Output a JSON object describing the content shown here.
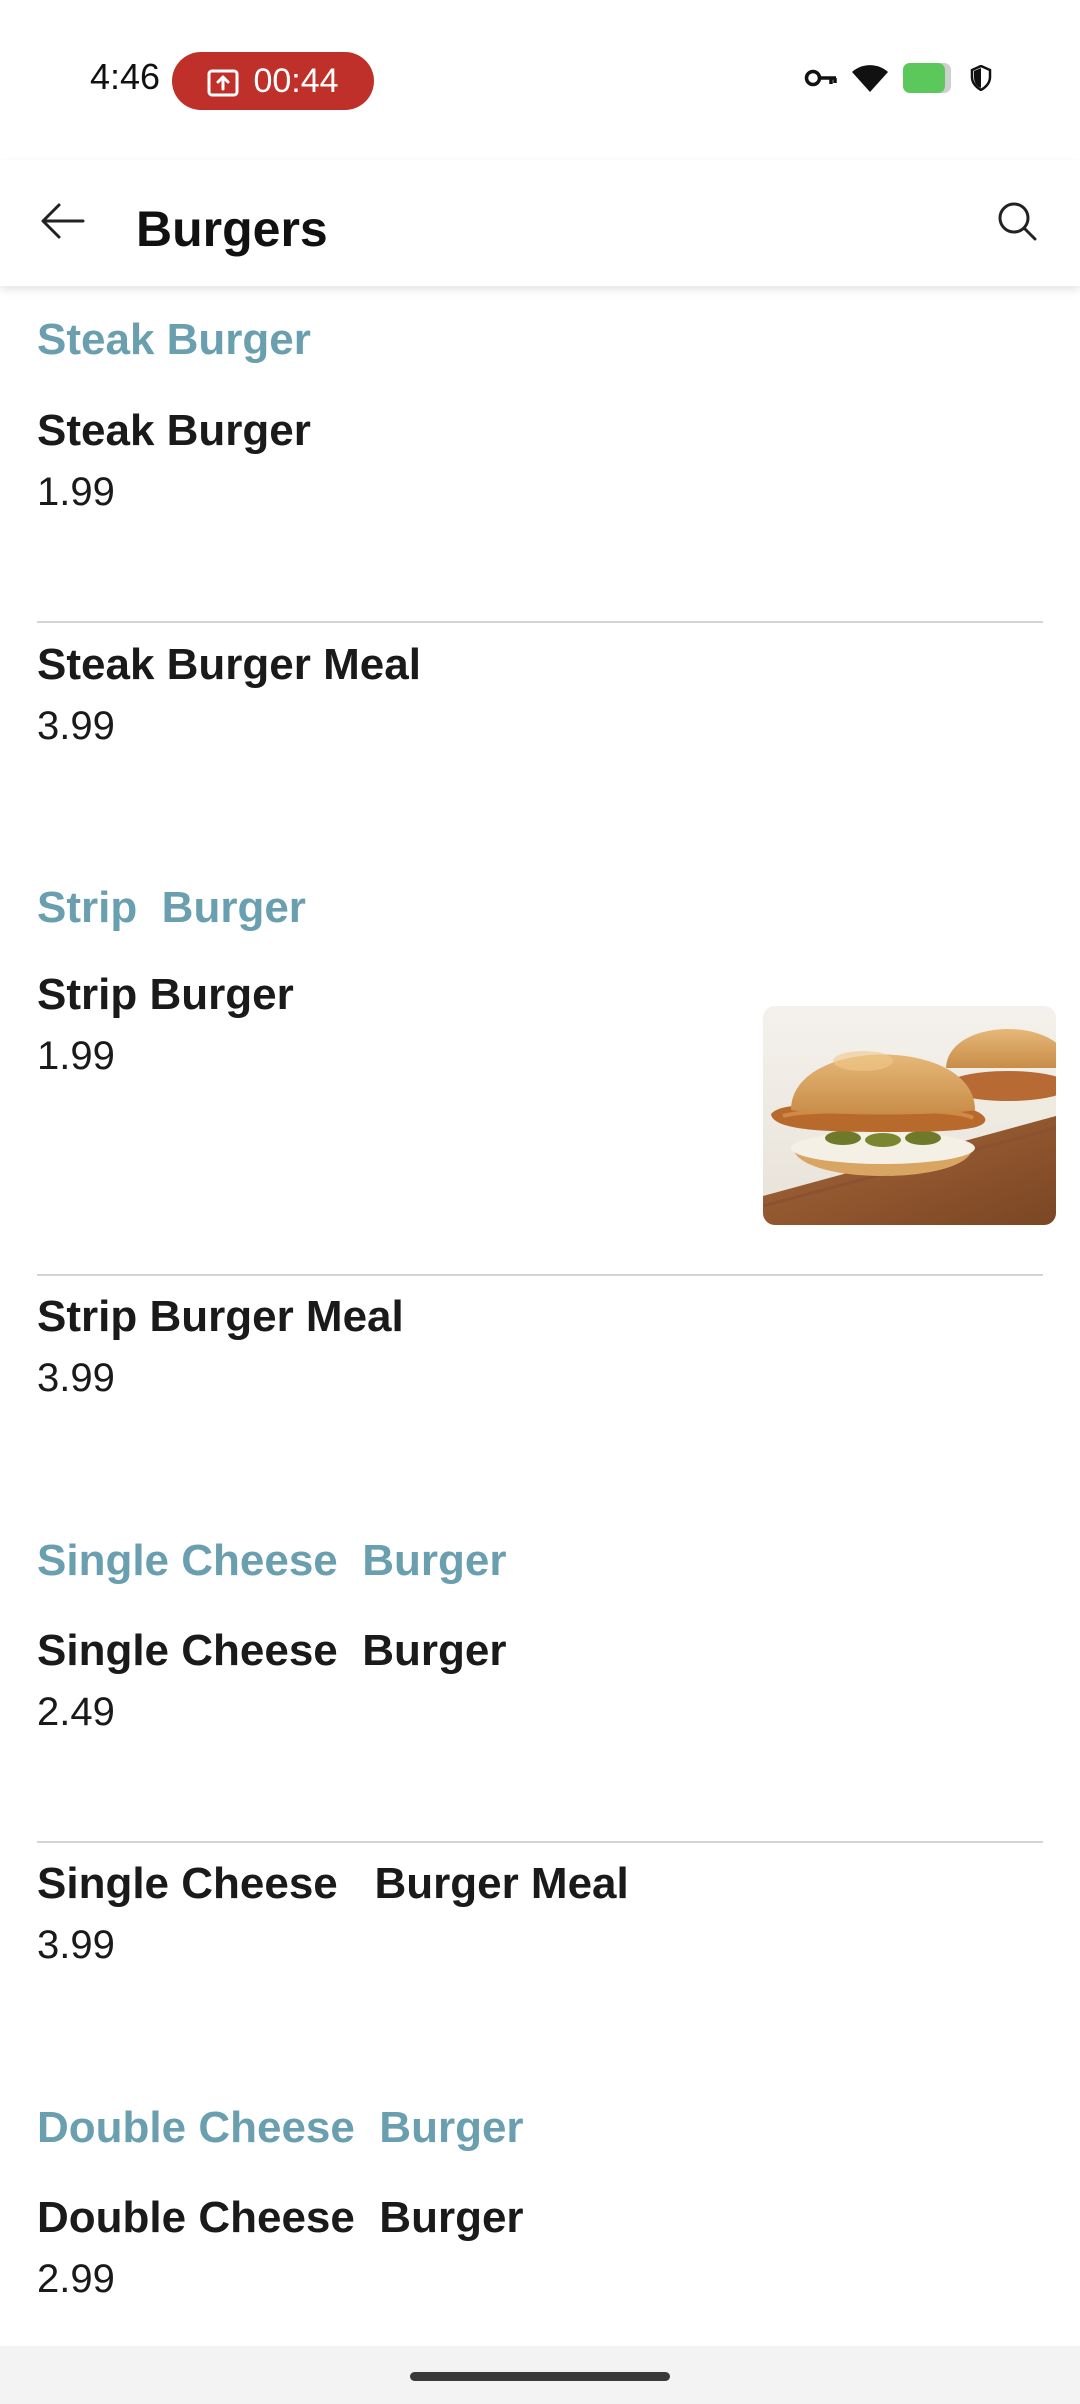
{
  "status_bar": {
    "time": "4:46",
    "recording_time": "00:44",
    "icons": [
      "screen-record-icon",
      "vpn-key-icon",
      "wifi-icon",
      "battery-icon",
      "shield-icon"
    ],
    "record_pill_color": "#c0302a",
    "battery_color": "#5cc85c"
  },
  "app_bar": {
    "title": "Burgers",
    "back_icon": "arrow-left-icon",
    "search_icon": "search-icon"
  },
  "colors": {
    "section_header": "#6a9fb0",
    "divider": "#d4d4d4"
  },
  "menu": [
    {
      "section": "Steak Burger",
      "items": [
        {
          "name": "Steak Burger",
          "price": "1.99"
        },
        {
          "name": "Steak Burger Meal",
          "price": "3.99"
        }
      ]
    },
    {
      "section": "Strip  Burger",
      "items": [
        {
          "name": "Strip Burger",
          "price": "1.99",
          "image": "chicken-strip-burger-photo"
        },
        {
          "name": "Strip Burger Meal",
          "price": "3.99"
        }
      ]
    },
    {
      "section": "Single Cheese  Burger",
      "items": [
        {
          "name": "Single Cheese  Burger",
          "price": "2.49"
        },
        {
          "name": "Single Cheese   Burger Meal",
          "price": "3.99"
        }
      ]
    },
    {
      "section": "Double Cheese  Burger",
      "items": [
        {
          "name": "Double Cheese  Burger",
          "price": "2.99"
        }
      ]
    }
  ]
}
